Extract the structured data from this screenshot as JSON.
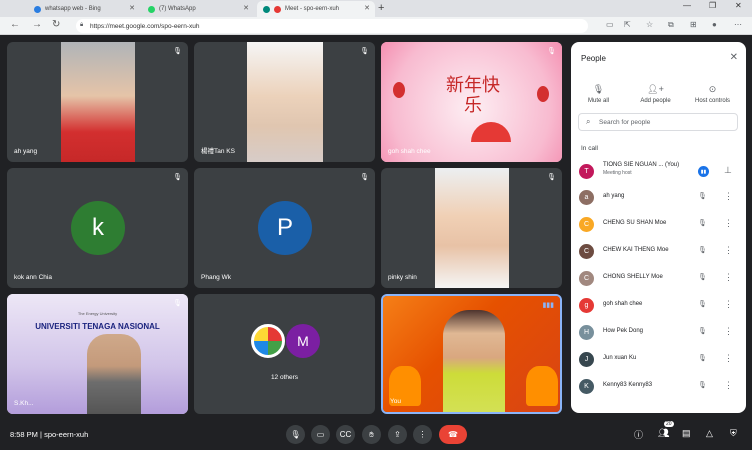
{
  "browser": {
    "tabs": [
      {
        "label": "whatsapp web - Bing"
      },
      {
        "label": "(7) WhatsApp"
      },
      {
        "label": "Meet - spo-eern-xuh"
      }
    ],
    "new_tab": "+",
    "url": "https://meet.google.com/spo-eern-xuh",
    "window_controls": [
      "—",
      "❐",
      "✕"
    ]
  },
  "tiles": [
    {
      "name": "ah yang",
      "type": "video"
    },
    {
      "name": "楊禮Tan KS",
      "type": "video"
    },
    {
      "name": "goh shah chee",
      "type": "image",
      "image_text": "新年快乐"
    },
    {
      "name": "kok ann Chia",
      "type": "avatar",
      "letter": "k",
      "color": "#2e7d32"
    },
    {
      "name": "Phang Wk",
      "type": "avatar",
      "letter": "P",
      "color": "#1a5fa8"
    },
    {
      "name": "pinky shin",
      "type": "video"
    },
    {
      "name": "S.Kh...",
      "type": "video",
      "banner": "UNIVERSITI TENAGA NASIONAL",
      "banner_sub": "The Energy University"
    },
    {
      "name": "12 others",
      "type": "others",
      "letter": "M",
      "color": "#7b1fa2"
    },
    {
      "name": "You",
      "type": "video"
    }
  ],
  "people_panel": {
    "title": "People",
    "actions": [
      "Mute all",
      "Add people",
      "Host controls"
    ],
    "search_placeholder": "Search for people",
    "section_label": "In call",
    "participants": [
      {
        "name": "TIONG SIE NGUAN ...",
        "suffix": "(You)",
        "sub": "Meeting host",
        "color": "#c2185b",
        "letter": "T"
      },
      {
        "name": "ah yang",
        "sub": "",
        "color": "#8d6e63",
        "letter": "a"
      },
      {
        "name": "CHENG SU SHAN Moe",
        "sub": "",
        "color": "#f9a825",
        "letter": "C"
      },
      {
        "name": "CHEW KAI THENG Moe",
        "sub": "",
        "color": "#6d4c41",
        "letter": "C"
      },
      {
        "name": "CHONG SHELLY Moe",
        "sub": "",
        "color": "#a1887f",
        "letter": "C"
      },
      {
        "name": "goh shah chee",
        "sub": "",
        "color": "#e53935",
        "letter": "g"
      },
      {
        "name": "How Pek Dong",
        "sub": "",
        "color": "#78909c",
        "letter": "H"
      },
      {
        "name": "Jun xuan Ku",
        "sub": "",
        "color": "#37474f",
        "letter": "J"
      },
      {
        "name": "Kenny83 Kenny83",
        "sub": "",
        "color": "#455a64",
        "letter": "K"
      }
    ]
  },
  "bottom_bar": {
    "time": "8:58 PM",
    "separator": "|",
    "meeting_code": "spo-eern-xuh",
    "people_count": "20"
  }
}
